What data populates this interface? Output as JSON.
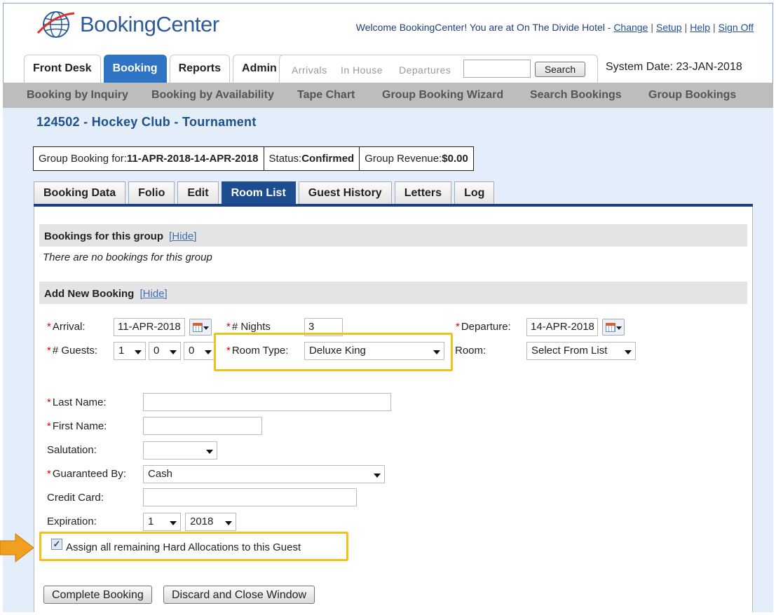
{
  "brand": {
    "name": "BookingCenter"
  },
  "header": {
    "welcome_text": "Welcome BookingCenter! You are at On The Divide Hotel -",
    "links": [
      "Change",
      "Setup",
      "Help",
      "Sign Off"
    ]
  },
  "main_tabs": [
    "Front Desk",
    "Booking",
    "Reports",
    "Admin"
  ],
  "active_main_tab": "Booking",
  "quick": {
    "arrivals": "Arrivals",
    "in_house": "In House",
    "departures": "Departures",
    "search_value": "",
    "search_button": "Search"
  },
  "system_date": "System Date: 23-JAN-2018",
  "subnav": [
    "Booking by Inquiry",
    "Booking by Availability",
    "Tape Chart",
    "Group Booking Wizard",
    "Search Bookings",
    "Group Bookings"
  ],
  "group_title": "124502 - Hockey Club - Tournament",
  "summary": {
    "booking_label": "Group Booking for:",
    "booking_value": "11-APR-2018-14-APR-2018",
    "status_label": "Status:",
    "status_value": "Confirmed",
    "revenue_label": "Group Revenue:",
    "revenue_value": "$0.00"
  },
  "detail_tabs": [
    "Booking Data",
    "Folio",
    "Edit",
    "Room List",
    "Guest History",
    "Letters",
    "Log"
  ],
  "active_detail_tab": "Room List",
  "bookings_section": {
    "title": "Bookings for this group",
    "hide": "[Hide]",
    "empty": "There are no bookings for this group"
  },
  "add_section": {
    "title": "Add New Booking",
    "hide": "[Hide]"
  },
  "form": {
    "arrival_label": "Arrival:",
    "arrival_value": "11-APR-2018",
    "nights_label": "# Nights",
    "nights_value": "3",
    "departure_label": "Departure:",
    "departure_value": "14-APR-2018",
    "guests_label": "# Guests:",
    "guests_values": [
      "1",
      "0",
      "0"
    ],
    "room_type_label": "Room Type:",
    "room_type_value": "Deluxe King",
    "room_label": "Room:",
    "room_value": "Select From List",
    "last_name_label": "Last Name:",
    "last_name_value": "",
    "first_name_label": "First Name:",
    "first_name_value": "",
    "salutation_label": "Salutation:",
    "salutation_value": "",
    "guaranteed_label": "Guaranteed By:",
    "guaranteed_value": "Cash",
    "credit_card_label": "Credit Card:",
    "credit_card_value": "",
    "expiration_label": "Expiration:",
    "exp_month": "1",
    "exp_year": "2018",
    "assign_label": "Assign all remaining Hard Allocations to this Guest",
    "assign_checked": true
  },
  "buttons": {
    "complete": "Complete Booking",
    "discard": "Discard and Close Window"
  },
  "colors": {
    "highlight": "#f2c11b",
    "arrow": "#f0a020",
    "active_tab": "#2f74c4",
    "detail_active": "#1e4d8f"
  }
}
